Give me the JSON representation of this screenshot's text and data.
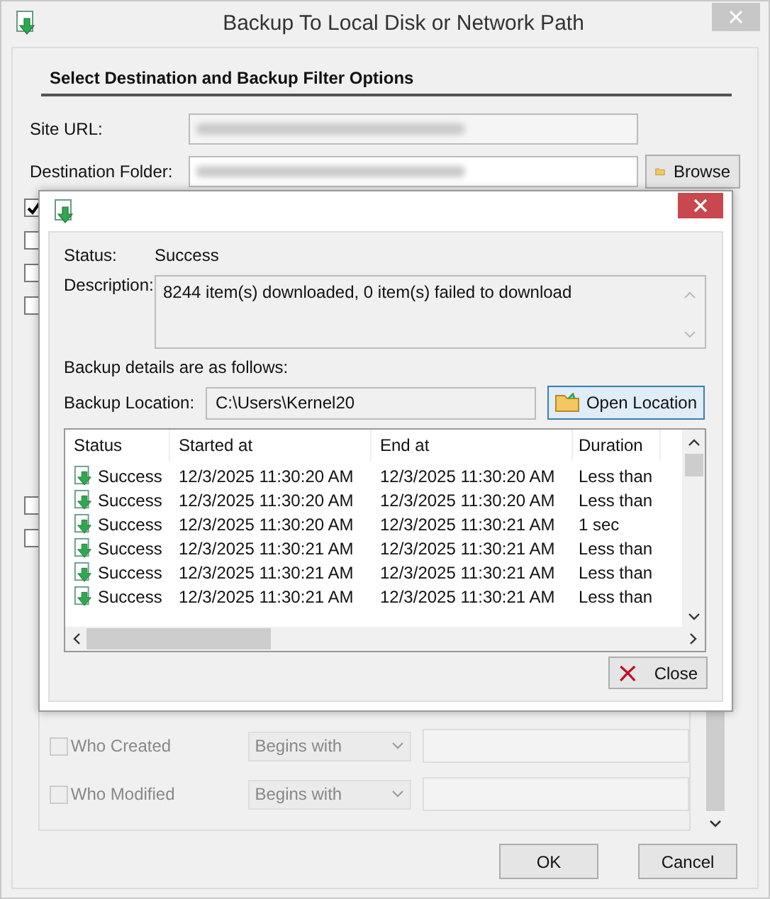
{
  "window": {
    "title": "Backup To Local Disk or Network Path"
  },
  "section_heading": "Select Destination and Backup Filter Options",
  "fields": [
    {
      "label": "Site URL:"
    },
    {
      "label": "Destination Folder:"
    }
  ],
  "browse_button": "Browse",
  "option_checkboxes": [
    {
      "checked": true
    },
    {
      "checked": false
    },
    {
      "checked": false
    },
    {
      "checked": false
    },
    {
      "checked": false
    },
    {
      "checked": false
    }
  ],
  "user_filter": {
    "disabled": true,
    "rows": [
      {
        "label": "Who Created",
        "checked": false,
        "operator": "Begins with"
      },
      {
        "label": "Who Modified",
        "checked": false,
        "operator": "Begins with"
      }
    ]
  },
  "buttons": [
    "OK",
    "Cancel"
  ],
  "dialog": {
    "status_label": "Status:",
    "status": "Success",
    "description_label": "Description:",
    "description": "8244 item(s) downloaded, 0 item(s) failed to download",
    "details_heading": "Backup details are as follows:",
    "location_label": "Backup Location:",
    "location": "C:\\Users\\Kernel20",
    "open_button": "Open Location",
    "table": {
      "columns": [
        "Status",
        "Started at",
        "End at",
        "Duration"
      ],
      "rows": [
        [
          "Success",
          "12/3/2025 11:30:20 AM",
          "12/3/2025 11:30:20 AM",
          "Less than"
        ],
        [
          "Success",
          "12/3/2025 11:30:20 AM",
          "12/3/2025 11:30:20 AM",
          "Less than"
        ],
        [
          "Success",
          "12/3/2025 11:30:20 AM",
          "12/3/2025 11:30:21 AM",
          "1 sec"
        ],
        [
          "Success",
          "12/3/2025 11:30:21 AM",
          "12/3/2025 11:30:21 AM",
          "Less than"
        ],
        [
          "Success",
          "12/3/2025 11:30:21 AM",
          "12/3/2025 11:30:21 AM",
          "Less than"
        ],
        [
          "Success",
          "12/3/2025 11:30:21 AM",
          "12/3/2025 11:30:21 AM",
          "Less than"
        ]
      ]
    },
    "close_button": "Close"
  }
}
